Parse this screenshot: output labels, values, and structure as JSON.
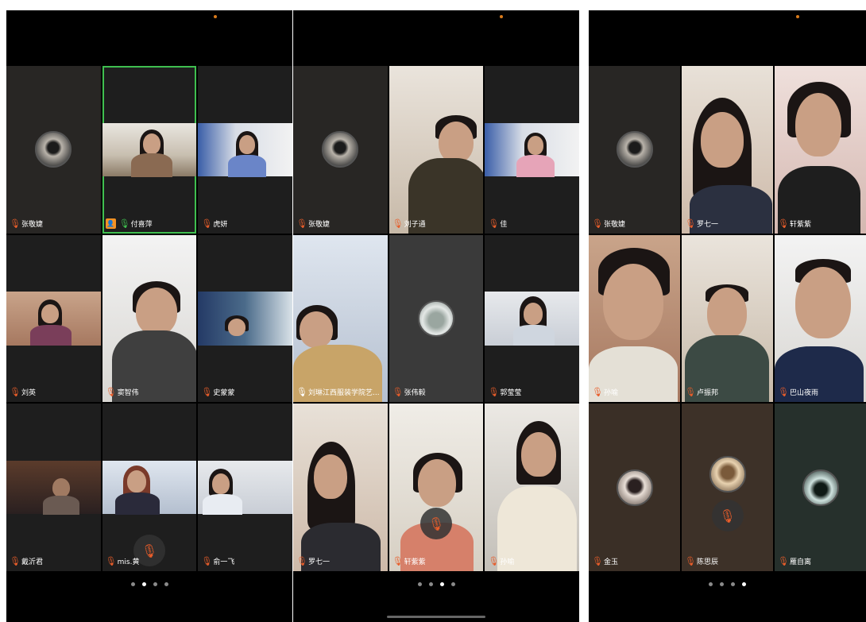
{
  "icons": {
    "mic_muted": "mic-muted-icon",
    "mic_active": "mic-active-icon",
    "host": "host-icon"
  },
  "colors": {
    "active_speaker_border": "#3fbf4f",
    "muted_icon": "#e85d2a",
    "host_badge": "#f39224",
    "background": "#000000"
  },
  "panels": [
    {
      "participants": [
        {
          "name": "张敬婕",
          "mic": "muted"
        },
        {
          "name": "付喜萍",
          "mic": "active",
          "host": true,
          "active_speaker": true
        },
        {
          "name": "虎妍",
          "mic": "muted"
        },
        {
          "name": "刘英",
          "mic": "muted"
        },
        {
          "name": "窦智伟",
          "mic": "muted"
        },
        {
          "name": "史蒙蒙",
          "mic": "muted"
        },
        {
          "name": "戴沂君",
          "mic": "muted"
        },
        {
          "name": "mis.黄",
          "mic": "muted"
        },
        {
          "name": "俞一飞",
          "mic": "muted"
        }
      ],
      "pager_active": 1,
      "pager_count": 4
    },
    {
      "participants": [
        {
          "name": "张敬婕",
          "mic": "muted"
        },
        {
          "name": "刘子通",
          "mic": "muted"
        },
        {
          "name": "佳",
          "mic": "muted"
        },
        {
          "name": "刘琳江西服装学院艺...",
          "mic": "unmuted"
        },
        {
          "name": "张伟毅",
          "mic": "muted"
        },
        {
          "name": "郭莹莹",
          "mic": "muted"
        },
        {
          "name": "罗七一",
          "mic": "muted"
        },
        {
          "name": "轩紫紫",
          "mic": "muted"
        },
        {
          "name": "孙喻",
          "mic": "muted"
        }
      ],
      "pager_active": 2,
      "pager_count": 4
    },
    {
      "participants": [
        {
          "name": "张敬婕",
          "mic": "muted"
        },
        {
          "name": "罗七一",
          "mic": "muted"
        },
        {
          "name": "轩紫紫",
          "mic": "muted"
        },
        {
          "name": "孙喻",
          "mic": "muted"
        },
        {
          "name": "卢振邦",
          "mic": "muted"
        },
        {
          "name": "巴山夜雨",
          "mic": "muted"
        },
        {
          "name": "金玉",
          "mic": "muted"
        },
        {
          "name": "陈思辰",
          "mic": "muted"
        },
        {
          "name": "雁自离",
          "mic": "muted"
        }
      ],
      "pager_active": 3,
      "pager_count": 4
    }
  ]
}
